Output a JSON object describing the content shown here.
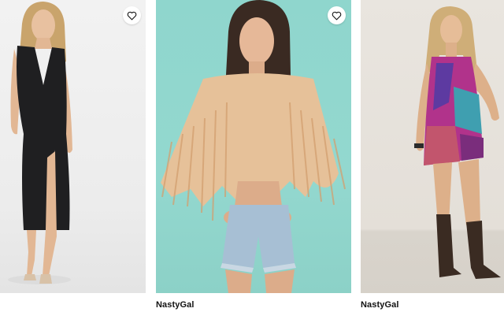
{
  "products": [
    {
      "brand": "",
      "photo_icon": "model-black-maxi-dress-image",
      "wishlist_icon": "heart-outline-icon"
    },
    {
      "brand": "NastyGal",
      "photo_icon": "model-fringe-sequin-top-image",
      "wishlist_icon": "heart-outline-icon"
    },
    {
      "brand": "NastyGal",
      "photo_icon": "model-patchwork-mini-dress-image"
    }
  ],
  "colors": {
    "photo1_bg": "#efefef",
    "photo2_bg": "#91d7ce",
    "photo3_bg": "#e6e1db",
    "brand_text": "#111111"
  }
}
